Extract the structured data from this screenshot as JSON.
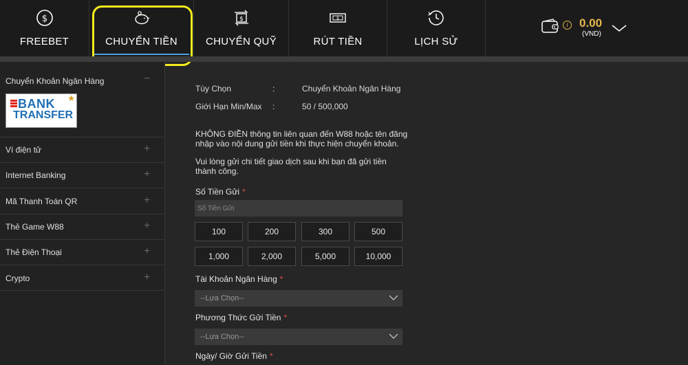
{
  "nav": {
    "tabs": [
      {
        "label": "FREEBET",
        "icon": "dollar-coin-icon"
      },
      {
        "label": "CHUYỂN TIỀN",
        "icon": "piggy-bank-icon"
      },
      {
        "label": "CHUYỂN QUỸ",
        "icon": "transfer-icon"
      },
      {
        "label": "RÚT TIỀN",
        "icon": "cash-withdraw-icon"
      },
      {
        "label": "LỊCH SỬ",
        "icon": "history-clock-icon"
      }
    ],
    "active": "CHUYỂN TIỀN",
    "balance": "0.00",
    "currency": "(VND)",
    "info_symbol": "i"
  },
  "colors": {
    "accent_gold": "#e6b84a",
    "highlight_ring": "#f5ec1d",
    "active_underline": "#4aa3df",
    "required": "#d9534f"
  },
  "sidebar": {
    "items": [
      {
        "label": "Chuyển Khoản Ngân Hàng",
        "sign": "−"
      },
      {
        "label": "Ví điện tử",
        "sign": "+"
      },
      {
        "label": "Internet Banking",
        "sign": "+"
      },
      {
        "label": "Mã Thanh Toán QR",
        "sign": "+"
      },
      {
        "label": "Thẻ Game W88",
        "sign": "+"
      },
      {
        "label": "Thẻ Điện Thoại",
        "sign": "+"
      },
      {
        "label": "Crypto",
        "sign": "+"
      }
    ],
    "bank_logo": {
      "line1": "BANK",
      "line2": "TRANSFER",
      "star": "★"
    }
  },
  "main": {
    "info": [
      {
        "key": "Tùy Chọn",
        "sep": ":",
        "value": "Chuyển Khoản Ngân Hàng"
      },
      {
        "key": "Giới Hạn Min/Max",
        "sep": ":",
        "value": "50 / 500,000"
      }
    ],
    "notice1": "KHÔNG ĐIỀN thông tin liên quan đến W88 hoặc tên đăng nhập vào nội dung gửi tiền khi thực hiện chuyển khoản.",
    "notice2": "Vui lòng gửi chi tiết giao dịch sau khi bạn đã gửi tiền thành công.",
    "amount_label": "Số Tiền Gửi",
    "amount_placeholder": "Số Tiền Gửi",
    "amounts": [
      "100",
      "200",
      "300",
      "500",
      "1,000",
      "2,000",
      "5,000",
      "10,000"
    ],
    "bank_account_label": "Tài Khoản Ngân Hàng",
    "bank_account_value": "--Lựa Chọn--",
    "method_label": "Phương Thức Gửi Tiền",
    "method_value": "--Lựa Chọn--",
    "datetime_label": "Ngày/ Giờ Gửi Tiền",
    "required_mark": "*"
  }
}
